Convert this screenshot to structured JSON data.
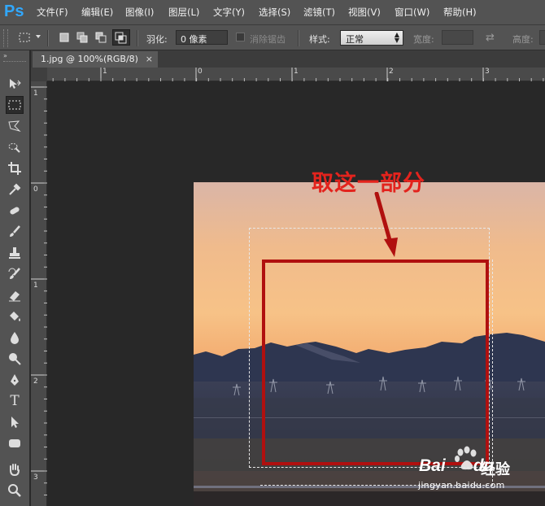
{
  "app": {
    "logo": "Ps"
  },
  "menu": [
    "文件(F)",
    "编辑(E)",
    "图像(I)",
    "图层(L)",
    "文字(Y)",
    "选择(S)",
    "滤镜(T)",
    "视图(V)",
    "窗口(W)",
    "帮助(H)"
  ],
  "options": {
    "feather_label": "羽化:",
    "feather_value": "0 像素",
    "antialias_label": "消除锯齿",
    "style_label": "样式:",
    "style_value": "正常",
    "width_label": "宽度:",
    "height_label": "高度:"
  },
  "document": {
    "tab_title": "1.jpg @ 100%(RGB/8)",
    "close": "×"
  },
  "rulers": {
    "horizontal": [
      "1",
      "0",
      "1",
      "2",
      "3"
    ],
    "vertical": [
      "1",
      "0",
      "1",
      "2",
      "3"
    ]
  },
  "annotation": {
    "text": "取这一部分",
    "color": "#e3231d"
  },
  "watermark": {
    "brand": "Bai",
    "brand2": "du",
    "jingyan": "经验",
    "url": "jingyan.baidu.com"
  },
  "colors": {
    "ui_gray": "#535353",
    "canvas_bg": "#282828",
    "accent_ps": "#31a8ff",
    "box_red": "#b0100f"
  },
  "tools": [
    "move-icon",
    "rect-marquee-icon",
    "polygon-lasso-icon",
    "quick-select-icon",
    "crop-icon",
    "eyedropper-icon",
    "healing-brush-icon",
    "brush-icon",
    "clone-stamp-icon",
    "history-brush-icon",
    "eraser-icon",
    "paint-bucket-icon",
    "blur-icon",
    "dodge-icon",
    "pen-icon",
    "type-icon",
    "path-select-icon",
    "shape-icon",
    "hand-icon",
    "zoom-icon"
  ]
}
